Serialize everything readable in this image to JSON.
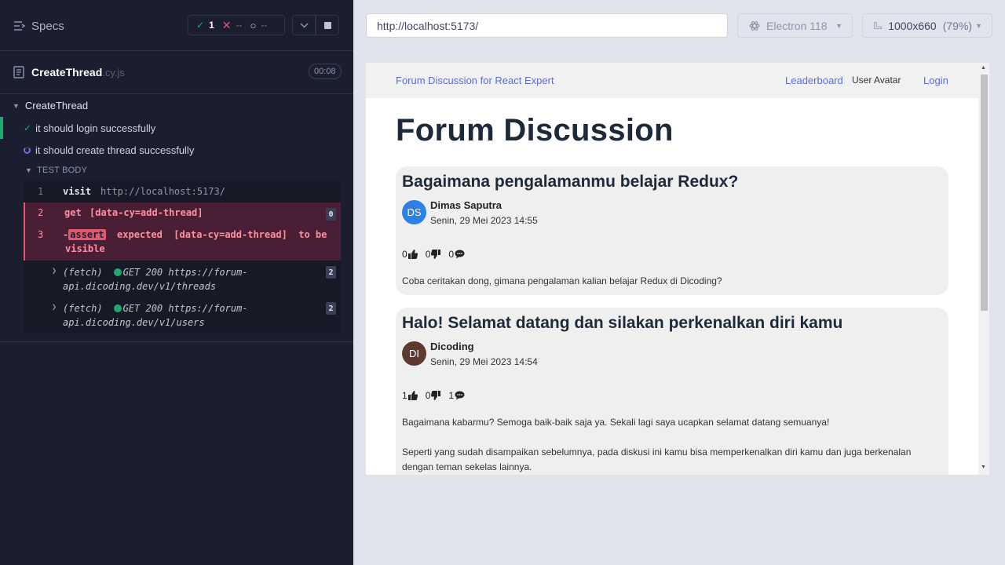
{
  "reporter": {
    "specs_label": "Specs",
    "stats": {
      "passed": "1",
      "failed": "--",
      "pending": "--"
    },
    "file_name": "CreateThread",
    "file_ext": ".cy.js",
    "duration": "00:08",
    "suite_title": "CreateThread",
    "tests": [
      {
        "title": "it should login successfully",
        "state": "passed"
      },
      {
        "title": "it should create thread successfully",
        "state": "running"
      }
    ],
    "test_body_label": "TEST BODY",
    "commands": [
      {
        "num": "1",
        "name": "visit",
        "message": "http://localhost:5173/"
      },
      {
        "num": "2",
        "name": "get",
        "message": "[data-cy=add-thread]",
        "badge": "0"
      },
      {
        "num": "3",
        "name": "assert",
        "prefix": "-",
        "message_a": "expected",
        "message_b": "[data-cy=add-thread]",
        "message_c": "to be",
        "message_d": "visible"
      }
    ],
    "fetches": [
      {
        "label": "(fetch)",
        "method": "GET 200",
        "url_a": "https://forum-",
        "url_b": "api.dicoding.dev/v1/threads",
        "badge": "2"
      },
      {
        "label": "(fetch)",
        "method": "GET 200",
        "url_a": "https://forum-",
        "url_b": "api.dicoding.dev/v1/users",
        "badge": "2"
      }
    ]
  },
  "topbar": {
    "url": "http://localhost:5173/",
    "browser": "Electron 118",
    "viewport": "1000x660",
    "zoom": "(79%)"
  },
  "app": {
    "brand": "Forum Discussion for React Expert",
    "nav": {
      "leaderboard": "Leaderboard",
      "avatar_alt": "User Avatar",
      "login": "Login"
    },
    "heading": "Forum Discussion",
    "threads": [
      {
        "title": "Bagaimana pengalamanmu belajar Redux?",
        "initials": "DS",
        "avatar_color": "#2f80e4",
        "author": "Dimas Saputra",
        "date": "Senin, 29 Mei 2023 14:55",
        "upvotes": "0",
        "downvotes": "0",
        "comments": "0",
        "body": "Coba ceritakan dong, gimana pengalaman kalian belajar Redux di Dicoding?"
      },
      {
        "title": "Halo! Selamat datang dan silakan perkenalkan diri kamu",
        "initials": "DI",
        "avatar_color": "#5d3a2e",
        "author": "Dicoding",
        "date": "Senin, 29 Mei 2023 14:54",
        "upvotes": "1",
        "downvotes": "0",
        "comments": "1",
        "body_p1": "Bagaimana kabarmu? Semoga baik-baik saja ya. Sekali lagi saya ucapkan selamat datang semuanya!",
        "body_p2": "Seperti yang sudah disampaikan sebelumnya, pada diskusi ini kamu bisa memperkenalkan diri kamu dan juga berkenalan dengan teman sekelas lainnya."
      }
    ]
  }
}
